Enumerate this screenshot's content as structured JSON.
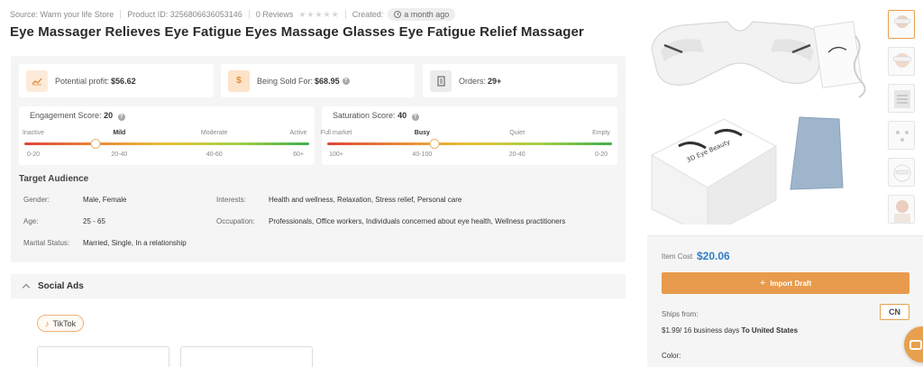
{
  "meta": {
    "source": "Source: Warm your life Store",
    "product_id": "Product ID: 3256806636053146",
    "reviews": "0 Reviews",
    "created_label": "Created:",
    "created_value": "a month ago",
    "rating_stars": 0
  },
  "product": {
    "title": "Eye Massager Relieves Eye Fatigue Eyes Massage Glasses Eye Fatigue Relief Massager"
  },
  "stats": {
    "profit_label": "Potential profit:",
    "profit_value": "$56.62",
    "sold_label": "Being Sold For:",
    "sold_value": "$68.95",
    "orders_label": "Orders:",
    "orders_value": "29+"
  },
  "engagement": {
    "label": "Engagement Score:",
    "value": "20",
    "levels": [
      "Inactive",
      "Mild",
      "Moderate",
      "Active"
    ],
    "ranges": [
      "0-20",
      "20-40",
      "40-60",
      "60+"
    ],
    "active_index": 1,
    "marker_fraction": 0.25
  },
  "saturation": {
    "label": "Saturation Score:",
    "value": "40",
    "levels": [
      "Full market",
      "Busy",
      "Quiet",
      "Empty"
    ],
    "ranges": [
      "100+",
      "40-100",
      "20-40",
      "0-20"
    ],
    "active_index": 1,
    "marker_fraction": 0.375
  },
  "audience": {
    "heading": "Target Audience",
    "gender_label": "Gender:",
    "gender_value": "Male, Female",
    "age_label": "Age:",
    "age_value": "25 - 65",
    "marital_label": "Marital Status:",
    "marital_value": "Married, Single, In a relationship",
    "interests_label": "Interests:",
    "interests_value": "Health and wellness, Relaxation, Stress relief, Personal care",
    "occupation_label": "Occupation:",
    "occupation_value": "Professionals, Office workers, Individuals concerned about eye health, Wellness practitioners"
  },
  "social": {
    "heading": "Social Ads",
    "platform": "TikTok"
  },
  "gallery": {
    "box_text": "3D Eye Beauty"
  },
  "buy": {
    "item_cost_label": "Item Cost",
    "item_cost_value": "$20.06",
    "import_label": "Import Draft",
    "origin": "CN",
    "ships_label": "Ships from:",
    "ships_price": "$1.99",
    "ships_days": "/ 16 business days",
    "ships_dest": "To United States",
    "color_label": "Color:"
  },
  "colors": {
    "accent": "#e89b4c",
    "price_blue": "#2e7ec7"
  }
}
